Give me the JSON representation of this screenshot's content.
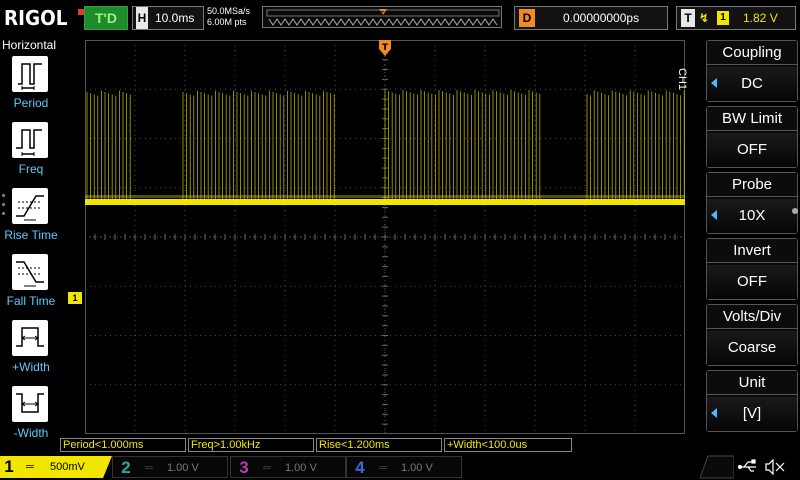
{
  "brand": "RIGOL",
  "top": {
    "run_status": "T'D",
    "horizontal_letter": "H",
    "timebase": "10.0ms",
    "sample_rate": "50.0MSa/s",
    "memory_depth": "6.00M pts",
    "delay_letter": "D",
    "delay_value": "0.00000000ps",
    "trigger_letter": "T",
    "trigger_channel": "1",
    "trigger_level": "1.82 V",
    "trigger_marker": "T"
  },
  "left_panel": {
    "title": "Horizontal",
    "items": [
      {
        "label": "Period"
      },
      {
        "label": "Freq"
      },
      {
        "label": "Rise Time"
      },
      {
        "label": "Fall Time"
      },
      {
        "label": "+Width"
      },
      {
        "label": "-Width"
      }
    ]
  },
  "right_panel": {
    "channel": "CH1",
    "buttons": [
      {
        "title": "Coupling",
        "value": "DC",
        "arrow": true
      },
      {
        "title": "BW Limit",
        "value": "OFF",
        "arrow": false
      },
      {
        "title": "Probe",
        "value": "10X",
        "arrow": true
      },
      {
        "title": "Invert",
        "value": "OFF",
        "arrow": false
      },
      {
        "title": "Volts/Div",
        "value": "Coarse",
        "arrow": false
      },
      {
        "title": "Unit",
        "value": "[V]",
        "arrow": true
      }
    ]
  },
  "measurements": [
    "Period<1.000ms",
    "Freq>1.00kHz",
    "Rise<1.200ms",
    "+Width<100.0us"
  ],
  "waveform": {
    "channel_marker": "1",
    "burst_count": 4
  },
  "channels": [
    {
      "num": "1",
      "scale": "500mV",
      "active": true,
      "color": "#f2e600"
    },
    {
      "num": "2",
      "scale": "1.00 V",
      "active": false,
      "color": "#2aa6a0"
    },
    {
      "num": "3",
      "scale": "1.00 V",
      "active": false,
      "color": "#b040b0"
    },
    {
      "num": "4",
      "scale": "1.00 V",
      "active": false,
      "color": "#3a6ad8"
    }
  ],
  "colors": {
    "ch1": "#f2e600",
    "accent_blue": "#4fb7ff",
    "trigger_orange": "#f08a24",
    "status_green": "#1e8c2c"
  }
}
